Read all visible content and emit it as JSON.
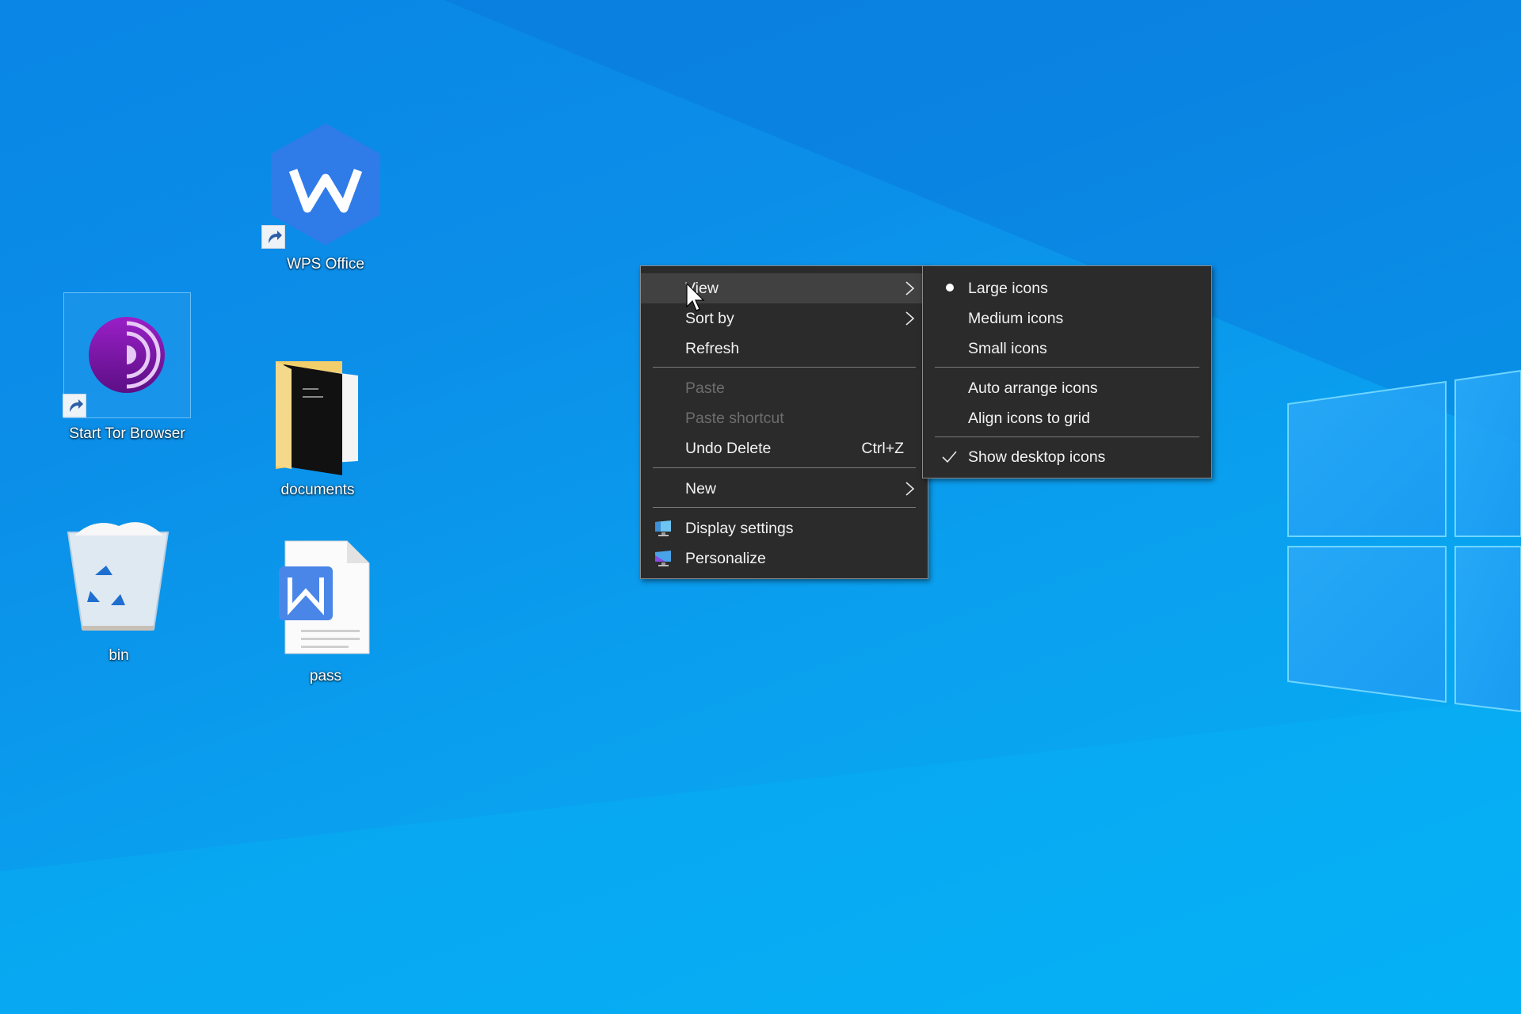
{
  "desktop": {
    "icons": [
      {
        "name": "WPS Office",
        "type": "shortcut"
      },
      {
        "name": "Start Tor Browser",
        "type": "shortcut",
        "selected": true
      },
      {
        "name": "documents",
        "type": "folder"
      },
      {
        "name": "bin",
        "type": "recycle-bin"
      },
      {
        "name": "pass",
        "type": "wps-document"
      }
    ]
  },
  "context_menu": {
    "items": [
      {
        "label": "View",
        "submenu": true,
        "highlighted": true
      },
      {
        "label": "Sort by",
        "submenu": true
      },
      {
        "label": "Refresh"
      },
      {
        "label": "Paste",
        "disabled": true
      },
      {
        "label": "Paste shortcut",
        "disabled": true
      },
      {
        "label": "Undo Delete",
        "shortcut": "Ctrl+Z"
      },
      {
        "label": "New",
        "submenu": true
      },
      {
        "label": "Display settings",
        "icon": "display-settings-icon"
      },
      {
        "label": "Personalize",
        "icon": "personalize-icon"
      }
    ]
  },
  "view_submenu": {
    "items": [
      {
        "label": "Large icons",
        "state": "selected-radio"
      },
      {
        "label": "Medium icons"
      },
      {
        "label": "Small icons"
      },
      {
        "label": "Auto arrange icons"
      },
      {
        "label": "Align icons to grid"
      },
      {
        "label": "Show desktop icons",
        "state": "checked"
      }
    ]
  },
  "colors": {
    "menu_bg": "#2b2b2b",
    "menu_hover": "#414141",
    "menu_text": "#f2f2f2",
    "menu_disabled": "#6d6d6d",
    "desktop_blue": "#0a9aee"
  }
}
